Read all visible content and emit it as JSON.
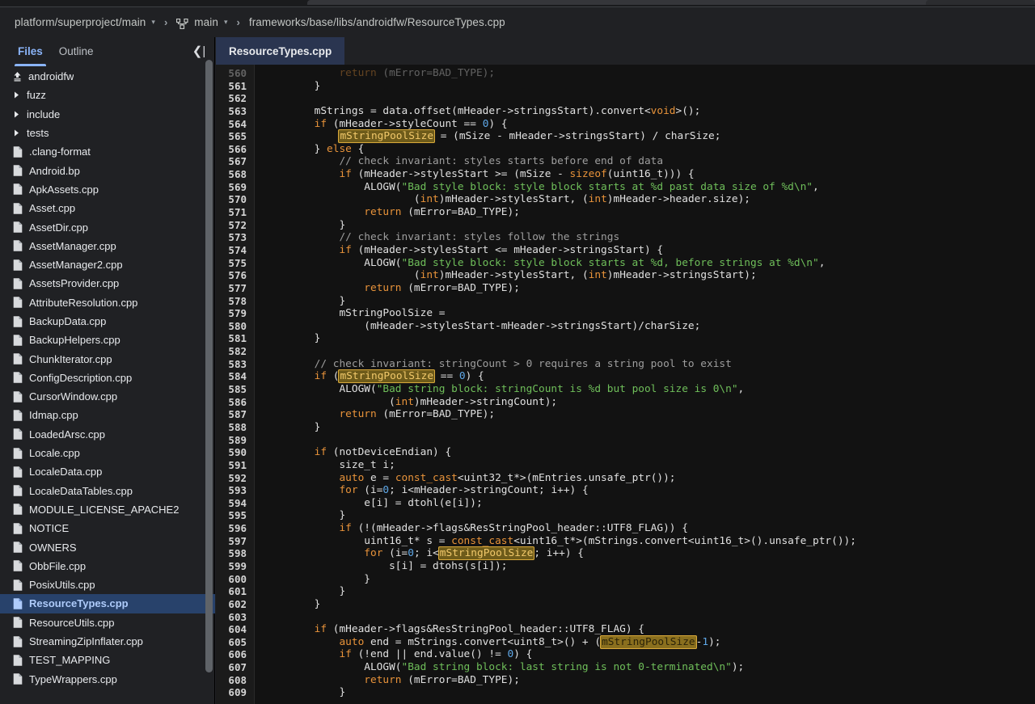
{
  "breadcrumb": {
    "project": "platform/superproject/main",
    "branch": "main",
    "branch_icon": "git-branch-icon",
    "path": "frameworks/base/libs/androidfw/ResourceTypes.cpp",
    "separator": "›",
    "caret": "▾"
  },
  "sidebar": {
    "tabs": [
      {
        "label": "Files",
        "active": true
      },
      {
        "label": "Outline",
        "active": false
      }
    ],
    "collapse_label": "❮|",
    "items": [
      {
        "label": "androidfw",
        "icon": "up-arrow-icon",
        "type": "up"
      },
      {
        "label": "fuzz",
        "icon": "chevron-right-icon",
        "type": "folder"
      },
      {
        "label": "include",
        "icon": "chevron-right-icon",
        "type": "folder"
      },
      {
        "label": "tests",
        "icon": "chevron-right-icon",
        "type": "folder"
      },
      {
        "label": ".clang-format",
        "icon": "file-icon",
        "type": "file"
      },
      {
        "label": "Android.bp",
        "icon": "file-icon",
        "type": "file"
      },
      {
        "label": "ApkAssets.cpp",
        "icon": "file-icon",
        "type": "file"
      },
      {
        "label": "Asset.cpp",
        "icon": "file-icon",
        "type": "file"
      },
      {
        "label": "AssetDir.cpp",
        "icon": "file-icon",
        "type": "file"
      },
      {
        "label": "AssetManager.cpp",
        "icon": "file-icon",
        "type": "file"
      },
      {
        "label": "AssetManager2.cpp",
        "icon": "file-icon",
        "type": "file"
      },
      {
        "label": "AssetsProvider.cpp",
        "icon": "file-icon",
        "type": "file"
      },
      {
        "label": "AttributeResolution.cpp",
        "icon": "file-icon",
        "type": "file"
      },
      {
        "label": "BackupData.cpp",
        "icon": "file-icon",
        "type": "file"
      },
      {
        "label": "BackupHelpers.cpp",
        "icon": "file-icon",
        "type": "file"
      },
      {
        "label": "ChunkIterator.cpp",
        "icon": "file-icon",
        "type": "file"
      },
      {
        "label": "ConfigDescription.cpp",
        "icon": "file-icon",
        "type": "file"
      },
      {
        "label": "CursorWindow.cpp",
        "icon": "file-icon",
        "type": "file"
      },
      {
        "label": "Idmap.cpp",
        "icon": "file-icon",
        "type": "file"
      },
      {
        "label": "LoadedArsc.cpp",
        "icon": "file-icon",
        "type": "file"
      },
      {
        "label": "Locale.cpp",
        "icon": "file-icon",
        "type": "file"
      },
      {
        "label": "LocaleData.cpp",
        "icon": "file-icon",
        "type": "file"
      },
      {
        "label": "LocaleDataTables.cpp",
        "icon": "file-icon",
        "type": "file"
      },
      {
        "label": "MODULE_LICENSE_APACHE2",
        "icon": "file-icon",
        "type": "file"
      },
      {
        "label": "NOTICE",
        "icon": "file-icon",
        "type": "file"
      },
      {
        "label": "OWNERS",
        "icon": "file-icon",
        "type": "file"
      },
      {
        "label": "ObbFile.cpp",
        "icon": "file-icon",
        "type": "file"
      },
      {
        "label": "PosixUtils.cpp",
        "icon": "file-icon",
        "type": "file"
      },
      {
        "label": "ResourceTypes.cpp",
        "icon": "file-icon",
        "type": "file",
        "selected": true
      },
      {
        "label": "ResourceUtils.cpp",
        "icon": "file-icon",
        "type": "file"
      },
      {
        "label": "StreamingZipInflater.cpp",
        "icon": "file-icon",
        "type": "file"
      },
      {
        "label": "TEST_MAPPING",
        "icon": "file-icon",
        "type": "file"
      },
      {
        "label": "TypeWrappers.cpp",
        "icon": "file-icon",
        "type": "file"
      }
    ]
  },
  "editor": {
    "tab_label": "ResourceTypes.cpp",
    "first_line": 560,
    "last_line": 609,
    "highlight_token": "mStringPoolSize",
    "colors": {
      "keyword": "#e8933a",
      "string": "#6fbf5a",
      "comment": "#9e9e9e",
      "number": "#5fa8e8",
      "highlight_bg": "#6e5b1a",
      "highlight_border": "#d9a93b",
      "accent": "#8ab4f8",
      "selection_bg": "#28426b"
    },
    "lines": [
      {
        "n": 560,
        "clipped": true,
        "html": "            <span class='kw'>return</span> (mError=BAD_TYPE);"
      },
      {
        "n": 561,
        "html": "        }"
      },
      {
        "n": 562,
        "html": ""
      },
      {
        "n": 563,
        "html": "        mStrings = data.offset(mHeader-&gt;stringsStart).convert&lt;<span class='kw'>void</span>&gt;();"
      },
      {
        "n": 564,
        "html": "        <span class='kw'>if</span> (mHeader-&gt;styleCount == <span class='num'>0</span>) {"
      },
      {
        "n": 565,
        "html": "            <span class='hl'>mStringPoolSize</span> = (mSize - mHeader-&gt;stringsStart) / charSize;"
      },
      {
        "n": 566,
        "html": "        } <span class='kw'>else</span> {"
      },
      {
        "n": 567,
        "html": "            <span class='cmt'>// check invariant: styles starts before end of data</span>"
      },
      {
        "n": 568,
        "html": "            <span class='kw'>if</span> (mHeader-&gt;stylesStart &gt;= (mSize - <span class='kw'>sizeof</span>(uint16_t))) {"
      },
      {
        "n": 569,
        "html": "                ALOGW(<span class='str'>\"Bad style block: style block starts at %d past data size of %d\\n\"</span>,"
      },
      {
        "n": 570,
        "html": "                        (<span class='kw'>int</span>)mHeader-&gt;stylesStart, (<span class='kw'>int</span>)mHeader-&gt;header.size);"
      },
      {
        "n": 571,
        "html": "                <span class='kw'>return</span> (mError=BAD_TYPE);"
      },
      {
        "n": 572,
        "html": "            }"
      },
      {
        "n": 573,
        "html": "            <span class='cmt'>// check invariant: styles follow the strings</span>"
      },
      {
        "n": 574,
        "html": "            <span class='kw'>if</span> (mHeader-&gt;stylesStart &lt;= mHeader-&gt;stringsStart) {"
      },
      {
        "n": 575,
        "html": "                ALOGW(<span class='str'>\"Bad style block: style block starts at %d, before strings at %d\\n\"</span>,"
      },
      {
        "n": 576,
        "html": "                        (<span class='kw'>int</span>)mHeader-&gt;stylesStart, (<span class='kw'>int</span>)mHeader-&gt;stringsStart);"
      },
      {
        "n": 577,
        "html": "                <span class='kw'>return</span> (mError=BAD_TYPE);"
      },
      {
        "n": 578,
        "html": "            }"
      },
      {
        "n": 579,
        "html": "            mStringPoolSize ="
      },
      {
        "n": 580,
        "html": "                (mHeader-&gt;stylesStart-mHeader-&gt;stringsStart)/charSize;"
      },
      {
        "n": 581,
        "html": "        }"
      },
      {
        "n": 582,
        "html": ""
      },
      {
        "n": 583,
        "html": "        <span class='cmt'>// check invariant: stringCount &gt; 0 requires a string pool to exist</span>"
      },
      {
        "n": 584,
        "html": "        <span class='kw'>if</span> (<span class='hl'>mStringPoolSize</span> == <span class='num'>0</span>) {"
      },
      {
        "n": 585,
        "html": "            ALOGW(<span class='str'>\"Bad string block: stringCount is %d but pool size is 0\\n\"</span>,"
      },
      {
        "n": 586,
        "html": "                    (<span class='kw'>int</span>)mHeader-&gt;stringCount);"
      },
      {
        "n": 587,
        "html": "            <span class='kw'>return</span> (mError=BAD_TYPE);"
      },
      {
        "n": 588,
        "html": "        }"
      },
      {
        "n": 589,
        "html": ""
      },
      {
        "n": 590,
        "html": "        <span class='kw'>if</span> (notDeviceEndian) {"
      },
      {
        "n": 591,
        "html": "            size_t i;"
      },
      {
        "n": 592,
        "html": "            <span class='kw'>auto</span> e = <span class='kw'>const_cast</span>&lt;uint32_t*&gt;(mEntries.unsafe_ptr());"
      },
      {
        "n": 593,
        "html": "            <span class='kw'>for</span> (i=<span class='num'>0</span>; i&lt;mHeader-&gt;stringCount; i++) {"
      },
      {
        "n": 594,
        "html": "                e[i] = dtohl(e[i]);"
      },
      {
        "n": 595,
        "html": "            }"
      },
      {
        "n": 596,
        "html": "            <span class='kw'>if</span> (!(mHeader-&gt;flags&amp;ResStringPool_header::UTF8_FLAG)) {"
      },
      {
        "n": 597,
        "html": "                uint16_t* s = <span class='kw'>const_cast</span>&lt;uint16_t*&gt;(mStrings.convert&lt;uint16_t&gt;().unsafe_ptr());"
      },
      {
        "n": 598,
        "html": "                <span class='kw'>for</span> (i=<span class='num'>0</span>; i&lt;<span class='hl'>mStringPoolSize</span>; i++) {"
      },
      {
        "n": 599,
        "html": "                    s[i] = dtohs(s[i]);"
      },
      {
        "n": 600,
        "html": "                }"
      },
      {
        "n": 601,
        "html": "            }"
      },
      {
        "n": 602,
        "html": "        }"
      },
      {
        "n": 603,
        "html": ""
      },
      {
        "n": 604,
        "html": "        <span class='kw'>if</span> (mHeader-&gt;flags&amp;ResStringPool_header::UTF8_FLAG) {"
      },
      {
        "n": 605,
        "html": "            <span class='kw'>auto</span> end = mStrings.convert&lt;uint8_t&gt;() + (<span class='hl solid'>mStringPoolSize</span>-<span class='num'>1</span>);"
      },
      {
        "n": 606,
        "html": "            <span class='kw'>if</span> (!end || end.value() != <span class='num'>0</span>) {"
      },
      {
        "n": 607,
        "html": "                ALOGW(<span class='str'>\"Bad string block: last string is not 0-terminated\\n\"</span>);"
      },
      {
        "n": 608,
        "html": "                <span class='kw'>return</span> (mError=BAD_TYPE);"
      },
      {
        "n": 609,
        "html": "            }"
      }
    ]
  }
}
